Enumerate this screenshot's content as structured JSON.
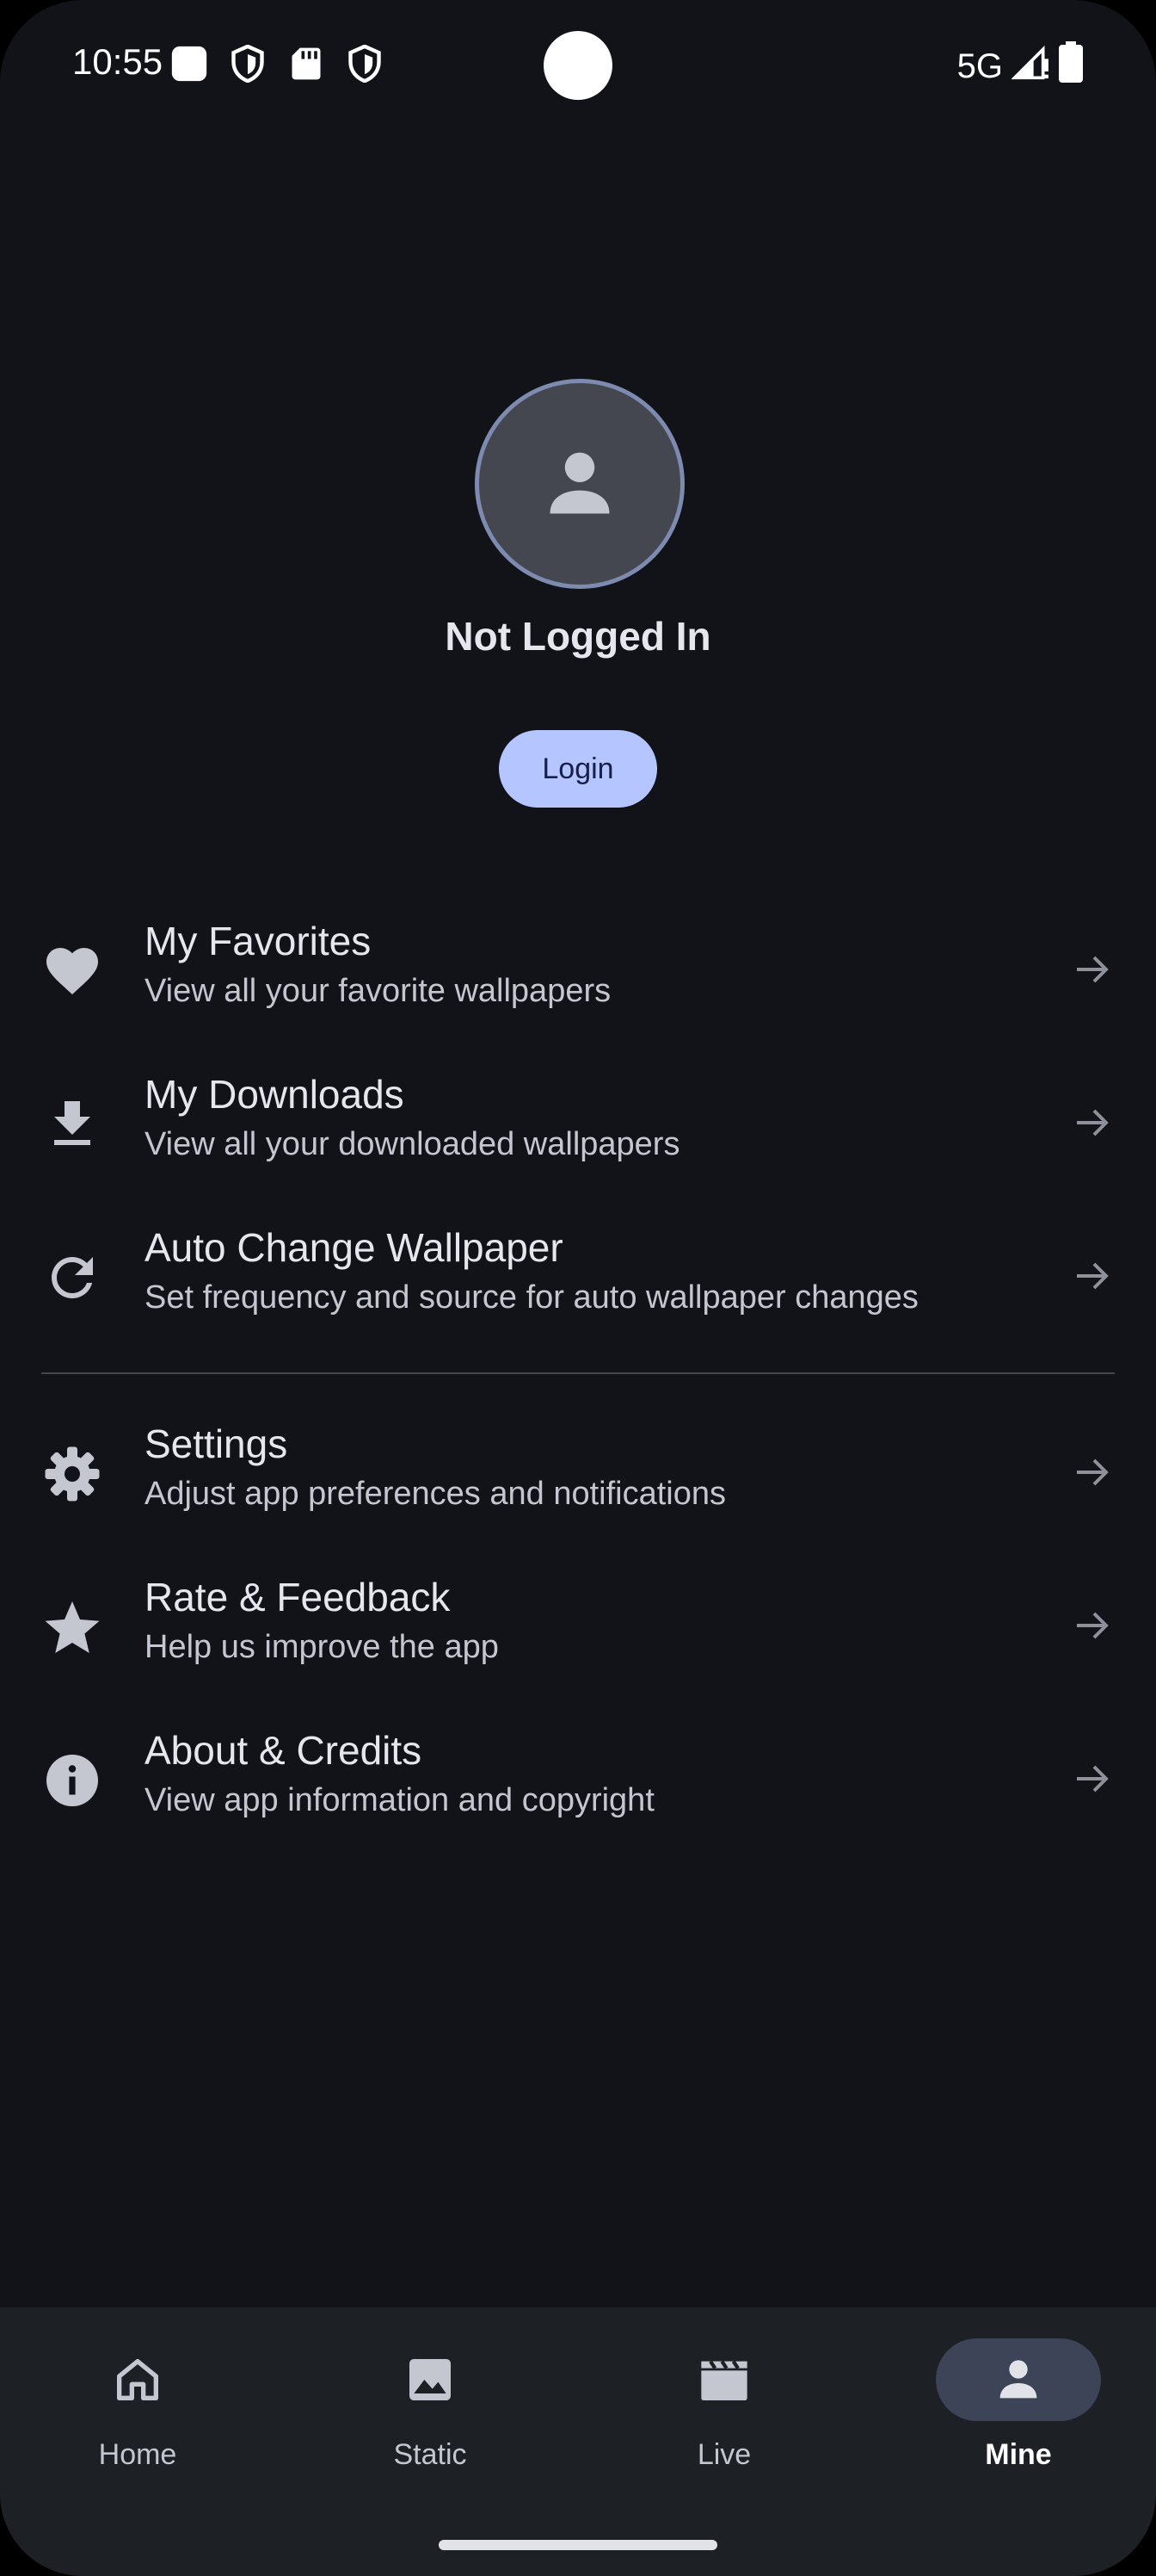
{
  "status_bar": {
    "time": "10:55",
    "network": "5G"
  },
  "profile": {
    "name": "Not Logged In",
    "login_label": "Login"
  },
  "menu": [
    {
      "title": "My Favorites",
      "subtitle": "View all your favorite wallpapers",
      "icon": "heart-icon"
    },
    {
      "title": "My Downloads",
      "subtitle": "View all your downloaded wallpapers",
      "icon": "download-icon"
    },
    {
      "title": "Auto Change Wallpaper",
      "subtitle": "Set frequency and source for auto wallpaper changes",
      "icon": "refresh-icon"
    },
    {
      "title": "Settings",
      "subtitle": "Adjust app preferences and notifications",
      "icon": "gear-icon"
    },
    {
      "title": "Rate & Feedback",
      "subtitle": "Help us improve the app",
      "icon": "star-icon"
    },
    {
      "title": "About & Credits",
      "subtitle": "View app information and copyright",
      "icon": "info-icon"
    }
  ],
  "nav": [
    {
      "label": "Home",
      "icon": "home-icon",
      "active": false
    },
    {
      "label": "Static",
      "icon": "image-icon",
      "active": false
    },
    {
      "label": "Live",
      "icon": "clapperboard-icon",
      "active": false
    },
    {
      "label": "Mine",
      "icon": "person-icon",
      "active": true
    }
  ],
  "colors": {
    "background": "#111318",
    "accent": "#b4c5ff",
    "nav_background": "#1d2025",
    "active_pill": "#3d4458"
  }
}
